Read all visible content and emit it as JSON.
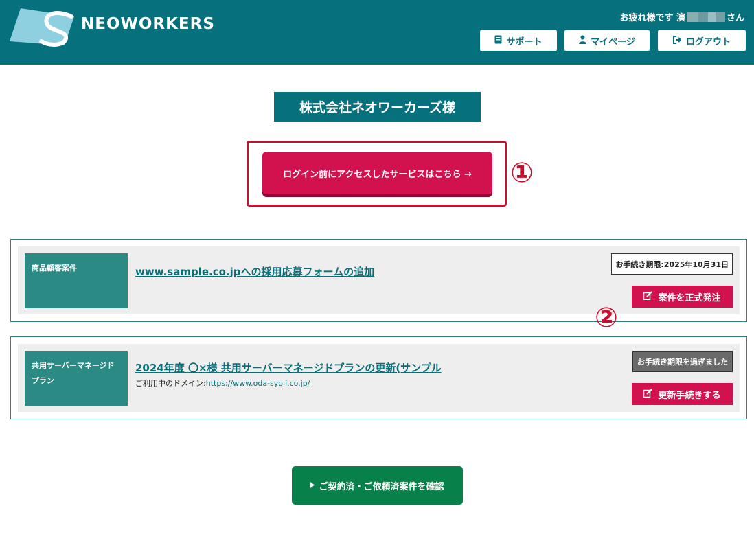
{
  "header": {
    "logo_text": "NEOWORKERS",
    "greeting_prefix": "お疲れ様です 演",
    "greeting_suffix": "さん",
    "buttons": [
      {
        "icon": "book-icon",
        "label": "サポート"
      },
      {
        "icon": "user-icon",
        "label": "マイページ"
      },
      {
        "icon": "logout-icon",
        "label": "ログアウト"
      }
    ]
  },
  "company_name": "株式会社ネオワーカーズ様",
  "service_button": "ログイン前にアクセスしたサービスはこちら →",
  "annotations": {
    "one": "①",
    "two": "②"
  },
  "cards": [
    {
      "category": "商品顧客案件",
      "title": "www.sample.co.jpへの採用応募フォームの追加",
      "status": "お手続き期限:2025年10月31日",
      "action": "案件を正式発注"
    },
    {
      "category": "共用サーバーマネージドプラン",
      "title": "2024年度 〇×様 共用サーバーマネージドプランの更新(サンプル",
      "domain_label": "ご利用中のドメイン:",
      "domain_url": "https://www.oda-syoji.co.jp/",
      "status": "お手続き期限を過ぎました",
      "action": "更新手続きする"
    }
  ],
  "confirm_button": "ご契約済・ご依頼済案件を確認",
  "colors": {
    "brand": "#06707c",
    "accent": "#d2124f",
    "category": "#2b8a84",
    "confirm": "#08804a",
    "callout": "#c8102e"
  }
}
